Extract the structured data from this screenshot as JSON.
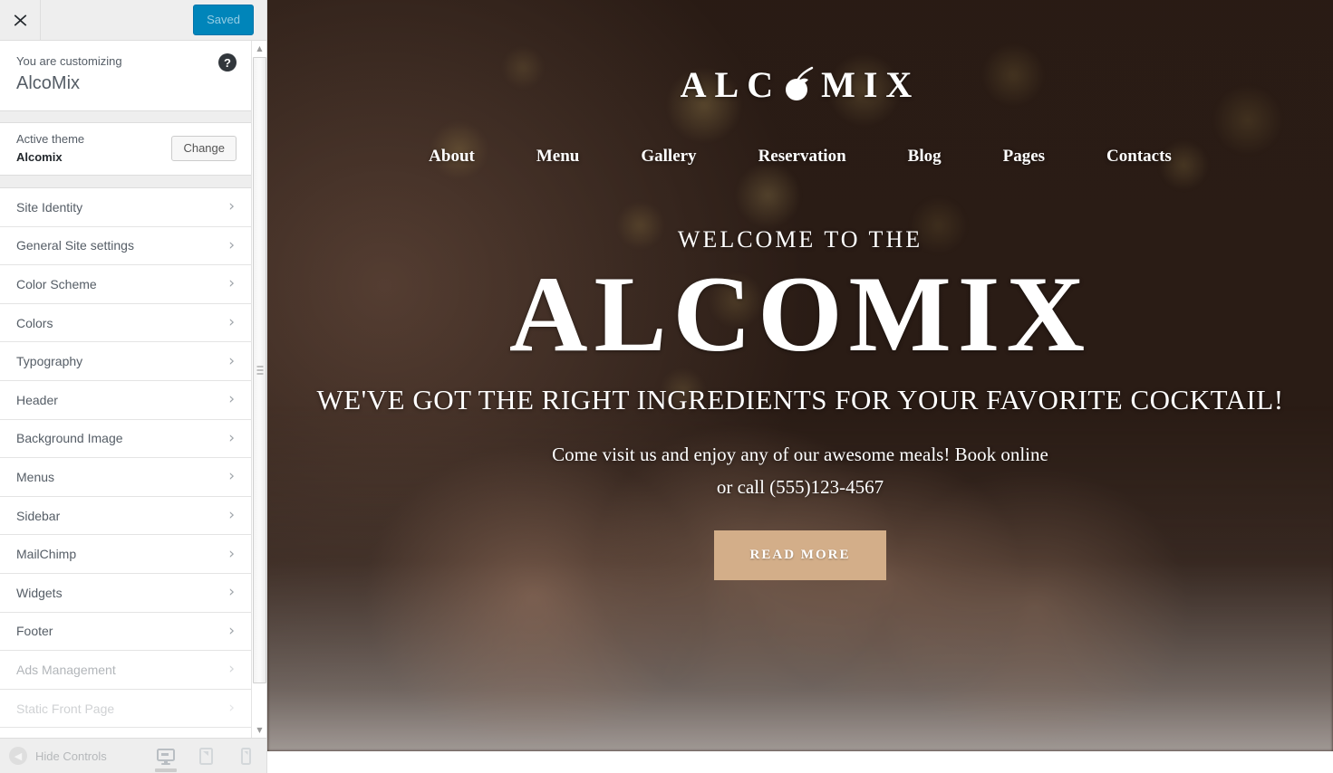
{
  "customizer": {
    "close_icon": "close-x-icon",
    "save_label": "Saved",
    "info_label": "You are customizing",
    "info_title": "AlcoMix",
    "help_icon": "?",
    "theme_label": "Active theme",
    "theme_name": "Alcomix",
    "change_label": "Change",
    "sections": [
      {
        "label": "Site Identity",
        "state": "normal"
      },
      {
        "label": "General Site settings",
        "state": "normal"
      },
      {
        "label": "Color Scheme",
        "state": "normal"
      },
      {
        "label": "Colors",
        "state": "normal"
      },
      {
        "label": "Typography",
        "state": "normal"
      },
      {
        "label": "Header",
        "state": "normal"
      },
      {
        "label": "Background Image",
        "state": "normal"
      },
      {
        "label": "Menus",
        "state": "normal"
      },
      {
        "label": "Sidebar",
        "state": "normal"
      },
      {
        "label": "MailChimp",
        "state": "normal"
      },
      {
        "label": "Widgets",
        "state": "normal"
      },
      {
        "label": "Footer",
        "state": "normal"
      },
      {
        "label": "Ads Management",
        "state": "fade1"
      },
      {
        "label": "Static Front Page",
        "state": "fade2"
      }
    ],
    "chevron": "›",
    "bottom": {
      "hide_controls_label": "Hide Controls",
      "devices": [
        {
          "name": "desktop",
          "active": true
        },
        {
          "name": "tablet",
          "active": false
        },
        {
          "name": "mobile",
          "active": false
        }
      ]
    },
    "colors": {
      "save_button_bg": "#0085ba",
      "save_button_text": "#94cde4",
      "sidebar_bg": "#eeeeee",
      "panel_bg": "#ffffff",
      "text": "#555d66"
    }
  },
  "preview": {
    "logo": {
      "text_before": "ALC",
      "text_after": "MIX",
      "cherry_icon": "cherry-icon"
    },
    "nav": [
      {
        "label": "About"
      },
      {
        "label": "Menu"
      },
      {
        "label": "Gallery"
      },
      {
        "label": "Reservation"
      },
      {
        "label": "Blog"
      },
      {
        "label": "Pages"
      },
      {
        "label": "Contacts"
      }
    ],
    "hero": {
      "welcome": "WELCOME TO THE",
      "title": "ALCOMIX",
      "subtitle": "WE'VE GOT THE RIGHT INGREDIENTS FOR YOUR FAVORITE COCKTAIL!",
      "description_line1": "Come visit us and enjoy any of our awesome meals! Book online",
      "description_line2": "or call (555)123-4567",
      "cta_label": "READ MORE",
      "cta_bg": "#d3ae89"
    }
  }
}
